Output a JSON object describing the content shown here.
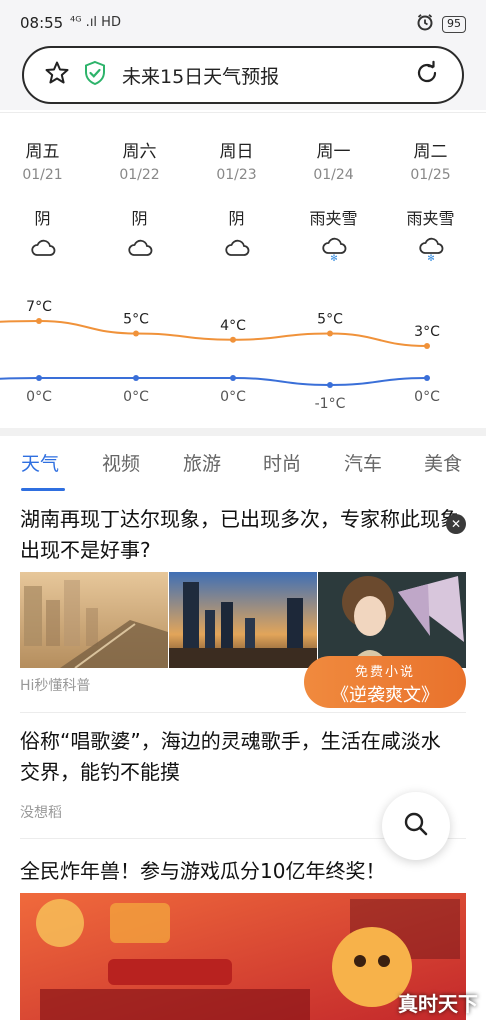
{
  "status_bar": {
    "time": "08:55",
    "network": "⁴ᴳ .ıl HD",
    "battery": "95"
  },
  "search": {
    "title": "未来15日天气预报"
  },
  "forecast": {
    "days": [
      {
        "name": "周五",
        "date": "01/21",
        "condition": "阴",
        "icon": "cloud-icon",
        "high": "7°C",
        "low": "0°C"
      },
      {
        "name": "周六",
        "date": "01/22",
        "condition": "阴",
        "icon": "cloud-icon",
        "high": "5°C",
        "low": "0°C"
      },
      {
        "name": "周日",
        "date": "01/23",
        "condition": "阴",
        "icon": "cloud-icon",
        "high": "4°C",
        "low": "0°C"
      },
      {
        "name": "周一",
        "date": "01/24",
        "condition": "雨夹雪",
        "icon": "sleet-icon",
        "high": "5°C",
        "low": "-1°C"
      },
      {
        "name": "周二",
        "date": "01/25",
        "condition": "雨夹雪",
        "icon": "sleet-icon",
        "high": "3°C",
        "low": "0°C"
      }
    ],
    "high_values": [
      7,
      5,
      4,
      5,
      3
    ],
    "low_values": [
      0,
      0,
      0,
      -1,
      0
    ],
    "colors": {
      "high_line": "#f0923a",
      "low_line": "#3a6fd8"
    }
  },
  "tabs": [
    {
      "label": "天气",
      "active": true
    },
    {
      "label": "视频",
      "active": false
    },
    {
      "label": "旅游",
      "active": false
    },
    {
      "label": "时尚",
      "active": false
    },
    {
      "label": "汽车",
      "active": false
    },
    {
      "label": "美食",
      "active": false
    }
  ],
  "feed": {
    "article1": {
      "title": "湖南再现丁达尔现象，已出现多次，专家称此现象出现不是好事?",
      "source": "Hi秒懂科普",
      "close": "✕"
    },
    "promo": {
      "sub": "免费小说",
      "main": "《逆袭爽文》"
    },
    "article2": {
      "title": "俗称“唱歌婆”，海边的灵魂歌手，生活在咸淡水交界，能钓不能摸",
      "source": "没想稻"
    },
    "article3": {
      "title": "全民炸年兽！参与游戏瓜分10亿年终奖！"
    }
  },
  "watermark": "真时天下"
}
